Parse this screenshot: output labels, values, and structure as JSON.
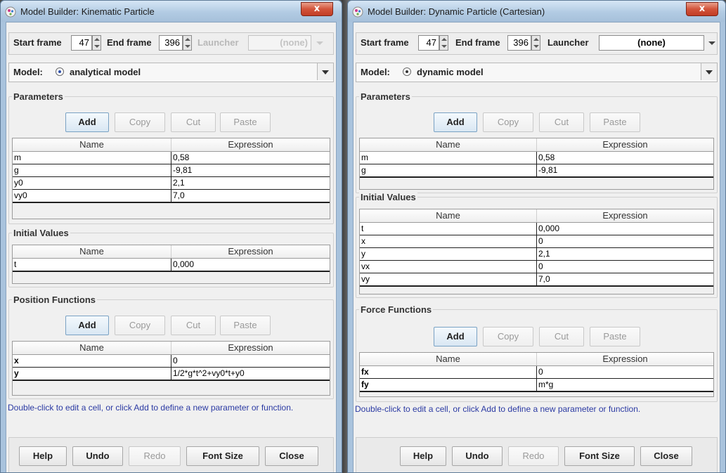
{
  "left": {
    "title": "Model Builder: Kinematic Particle",
    "close": "x",
    "start_frame_label": "Start frame",
    "start_frame": "47",
    "end_frame_label": "End frame",
    "end_frame": "396",
    "launcher_label": "Launcher",
    "launcher_value": "(none)",
    "model_label": "Model:",
    "model_value": "analytical model",
    "parameters": {
      "title": "Parameters",
      "add": "Add",
      "copy": "Copy",
      "cut": "Cut",
      "paste": "Paste",
      "col_name": "Name",
      "col_expr": "Expression",
      "rows": [
        [
          "m",
          "0,58"
        ],
        [
          "g",
          "-9,81"
        ],
        [
          "y0",
          "2,1"
        ],
        [
          "vy0",
          "7,0"
        ]
      ]
    },
    "initial": {
      "title": "Initial Values",
      "col_name": "Name",
      "col_expr": "Expression",
      "rows": [
        [
          "t",
          "0,000"
        ]
      ]
    },
    "functions": {
      "title": "Position Functions",
      "add": "Add",
      "copy": "Copy",
      "cut": "Cut",
      "paste": "Paste",
      "col_name": "Name",
      "col_expr": "Expression",
      "rows": [
        [
          "x",
          "0"
        ],
        [
          "y",
          "1/2*g*t^2+vy0*t+y0"
        ]
      ]
    },
    "help": "Double-click to edit a cell, or click Add to define a new parameter or function.",
    "footer": {
      "help": "Help",
      "undo": "Undo",
      "redo": "Redo",
      "font_size": "Font Size",
      "close": "Close"
    }
  },
  "right": {
    "title": "Model Builder: Dynamic Particle (Cartesian)",
    "close": "x",
    "start_frame_label": "Start frame",
    "start_frame": "47",
    "end_frame_label": "End frame",
    "end_frame": "396",
    "launcher_label": "Launcher",
    "launcher_value": "(none)",
    "model_label": "Model:",
    "model_value": "dynamic model",
    "parameters": {
      "title": "Parameters",
      "add": "Add",
      "copy": "Copy",
      "cut": "Cut",
      "paste": "Paste",
      "col_name": "Name",
      "col_expr": "Expression",
      "rows": [
        [
          "m",
          "0,58"
        ],
        [
          "g",
          "-9,81"
        ]
      ]
    },
    "initial": {
      "title": "Initial Values",
      "col_name": "Name",
      "col_expr": "Expression",
      "rows": [
        [
          "t",
          "0,000"
        ],
        [
          "x",
          "0"
        ],
        [
          "y",
          "2,1"
        ],
        [
          "vx",
          "0"
        ],
        [
          "vy",
          "7,0"
        ]
      ]
    },
    "functions": {
      "title": "Force Functions",
      "add": "Add",
      "copy": "Copy",
      "cut": "Cut",
      "paste": "Paste",
      "col_name": "Name",
      "col_expr": "Expression",
      "rows": [
        [
          "fx",
          "0"
        ],
        [
          "fy",
          "m*g"
        ]
      ]
    },
    "help": "Double-click to edit a cell, or click Add to define a new parameter or function.",
    "footer": {
      "help": "Help",
      "undo": "Undo",
      "redo": "Redo",
      "font_size": "Font Size",
      "close": "Close"
    }
  }
}
